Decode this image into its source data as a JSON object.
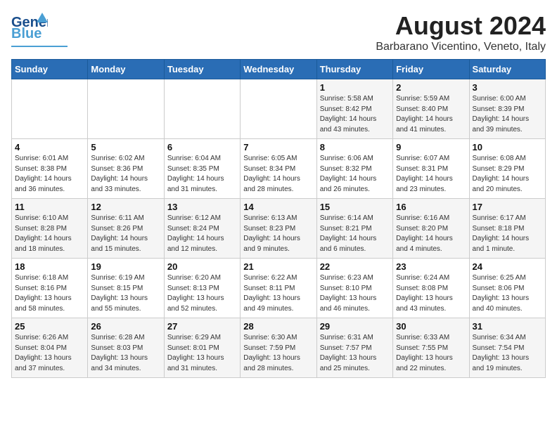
{
  "header": {
    "logo_general": "General",
    "logo_blue": "Blue",
    "month_year": "August 2024",
    "location": "Barbarano Vicentino, Veneto, Italy"
  },
  "days_of_week": [
    "Sunday",
    "Monday",
    "Tuesday",
    "Wednesday",
    "Thursday",
    "Friday",
    "Saturday"
  ],
  "weeks": [
    [
      {
        "day": "",
        "info": ""
      },
      {
        "day": "",
        "info": ""
      },
      {
        "day": "",
        "info": ""
      },
      {
        "day": "",
        "info": ""
      },
      {
        "day": "1",
        "info": "Sunrise: 5:58 AM\nSunset: 8:42 PM\nDaylight: 14 hours\nand 43 minutes."
      },
      {
        "day": "2",
        "info": "Sunrise: 5:59 AM\nSunset: 8:40 PM\nDaylight: 14 hours\nand 41 minutes."
      },
      {
        "day": "3",
        "info": "Sunrise: 6:00 AM\nSunset: 8:39 PM\nDaylight: 14 hours\nand 39 minutes."
      }
    ],
    [
      {
        "day": "4",
        "info": "Sunrise: 6:01 AM\nSunset: 8:38 PM\nDaylight: 14 hours\nand 36 minutes."
      },
      {
        "day": "5",
        "info": "Sunrise: 6:02 AM\nSunset: 8:36 PM\nDaylight: 14 hours\nand 33 minutes."
      },
      {
        "day": "6",
        "info": "Sunrise: 6:04 AM\nSunset: 8:35 PM\nDaylight: 14 hours\nand 31 minutes."
      },
      {
        "day": "7",
        "info": "Sunrise: 6:05 AM\nSunset: 8:34 PM\nDaylight: 14 hours\nand 28 minutes."
      },
      {
        "day": "8",
        "info": "Sunrise: 6:06 AM\nSunset: 8:32 PM\nDaylight: 14 hours\nand 26 minutes."
      },
      {
        "day": "9",
        "info": "Sunrise: 6:07 AM\nSunset: 8:31 PM\nDaylight: 14 hours\nand 23 minutes."
      },
      {
        "day": "10",
        "info": "Sunrise: 6:08 AM\nSunset: 8:29 PM\nDaylight: 14 hours\nand 20 minutes."
      }
    ],
    [
      {
        "day": "11",
        "info": "Sunrise: 6:10 AM\nSunset: 8:28 PM\nDaylight: 14 hours\nand 18 minutes."
      },
      {
        "day": "12",
        "info": "Sunrise: 6:11 AM\nSunset: 8:26 PM\nDaylight: 14 hours\nand 15 minutes."
      },
      {
        "day": "13",
        "info": "Sunrise: 6:12 AM\nSunset: 8:24 PM\nDaylight: 14 hours\nand 12 minutes."
      },
      {
        "day": "14",
        "info": "Sunrise: 6:13 AM\nSunset: 8:23 PM\nDaylight: 14 hours\nand 9 minutes."
      },
      {
        "day": "15",
        "info": "Sunrise: 6:14 AM\nSunset: 8:21 PM\nDaylight: 14 hours\nand 6 minutes."
      },
      {
        "day": "16",
        "info": "Sunrise: 6:16 AM\nSunset: 8:20 PM\nDaylight: 14 hours\nand 4 minutes."
      },
      {
        "day": "17",
        "info": "Sunrise: 6:17 AM\nSunset: 8:18 PM\nDaylight: 14 hours\nand 1 minute."
      }
    ],
    [
      {
        "day": "18",
        "info": "Sunrise: 6:18 AM\nSunset: 8:16 PM\nDaylight: 13 hours\nand 58 minutes."
      },
      {
        "day": "19",
        "info": "Sunrise: 6:19 AM\nSunset: 8:15 PM\nDaylight: 13 hours\nand 55 minutes."
      },
      {
        "day": "20",
        "info": "Sunrise: 6:20 AM\nSunset: 8:13 PM\nDaylight: 13 hours\nand 52 minutes."
      },
      {
        "day": "21",
        "info": "Sunrise: 6:22 AM\nSunset: 8:11 PM\nDaylight: 13 hours\nand 49 minutes."
      },
      {
        "day": "22",
        "info": "Sunrise: 6:23 AM\nSunset: 8:10 PM\nDaylight: 13 hours\nand 46 minutes."
      },
      {
        "day": "23",
        "info": "Sunrise: 6:24 AM\nSunset: 8:08 PM\nDaylight: 13 hours\nand 43 minutes."
      },
      {
        "day": "24",
        "info": "Sunrise: 6:25 AM\nSunset: 8:06 PM\nDaylight: 13 hours\nand 40 minutes."
      }
    ],
    [
      {
        "day": "25",
        "info": "Sunrise: 6:26 AM\nSunset: 8:04 PM\nDaylight: 13 hours\nand 37 minutes."
      },
      {
        "day": "26",
        "info": "Sunrise: 6:28 AM\nSunset: 8:03 PM\nDaylight: 13 hours\nand 34 minutes."
      },
      {
        "day": "27",
        "info": "Sunrise: 6:29 AM\nSunset: 8:01 PM\nDaylight: 13 hours\nand 31 minutes."
      },
      {
        "day": "28",
        "info": "Sunrise: 6:30 AM\nSunset: 7:59 PM\nDaylight: 13 hours\nand 28 minutes."
      },
      {
        "day": "29",
        "info": "Sunrise: 6:31 AM\nSunset: 7:57 PM\nDaylight: 13 hours\nand 25 minutes."
      },
      {
        "day": "30",
        "info": "Sunrise: 6:33 AM\nSunset: 7:55 PM\nDaylight: 13 hours\nand 22 minutes."
      },
      {
        "day": "31",
        "info": "Sunrise: 6:34 AM\nSunset: 7:54 PM\nDaylight: 13 hours\nand 19 minutes."
      }
    ]
  ]
}
